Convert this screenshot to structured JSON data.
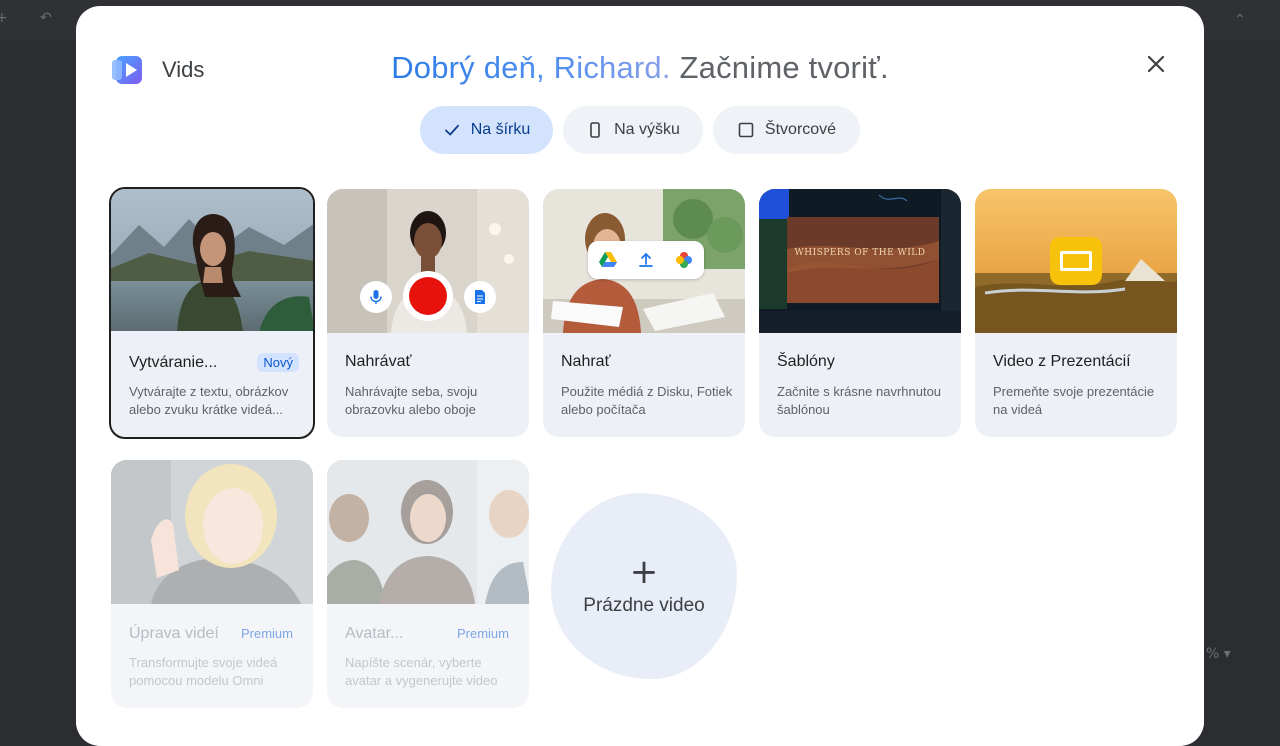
{
  "app": {
    "name": "Vids"
  },
  "greeting": {
    "name_part": "Dobrý deň, Richard.",
    "cta_part": "Začnime tvoriť."
  },
  "background": {
    "undo_glyph": "↶",
    "right_glyph": "⌃",
    "zoom_glyph": "% ▾"
  },
  "orientation": [
    {
      "label": "Na šírku",
      "icon": "check-icon",
      "selected": true
    },
    {
      "label": "Na výšku",
      "icon": "portrait-icon",
      "selected": false
    },
    {
      "label": "Štvorcové",
      "icon": "square-icon",
      "selected": false
    }
  ],
  "cards": [
    {
      "title": "Vytváranie...",
      "badge": "Nový",
      "desc": "Vytvárajte z textu, obrázkov alebo zvuku krátke videá..."
    },
    {
      "title": "Nahrávať",
      "desc": "Nahrávajte seba, svoju obrazovku alebo oboje"
    },
    {
      "title": "Nahrať",
      "desc": "Použite médiá z Disku, Fotiek alebo počítača"
    },
    {
      "title": "Šablóny",
      "desc": "Začnite s krásne navrhnutou šablónou",
      "thumb_text": "WHISPERS OF THE WILD"
    },
    {
      "title": "Video z Prezentácií",
      "desc": "Premeňte svoje prezentácie na videá"
    },
    {
      "title": "Úprava videí",
      "badge": "Premium",
      "desc": "Transformujte svoje videá pomocou modelu Omni"
    },
    {
      "title": "Avatar...",
      "badge": "Premium",
      "desc": "Napíšte scenár, vyberte avatar a vygenerujte video"
    }
  ],
  "blank": {
    "plus": "+",
    "label": "Prázdne video"
  },
  "colors": {
    "accent": "#0b57d0",
    "selected_chip": "#d3e3fd",
    "card_bg": "#edf0f6",
    "record": "#e8120c"
  }
}
